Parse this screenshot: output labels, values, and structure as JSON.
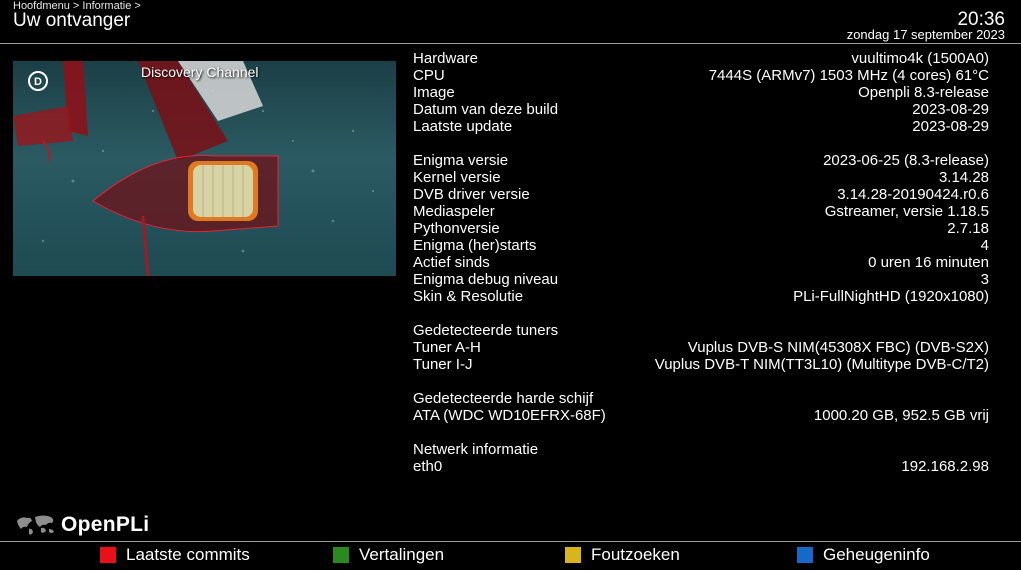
{
  "header": {
    "breadcrumb": "Hoofdmenu > Informatie >",
    "title": "Uw ontvanger",
    "time": "20:36",
    "date": "zondag 17 september 2023"
  },
  "preview": {
    "channel": "Discovery Channel",
    "logo_icon": "discovery-logo-icon"
  },
  "info": {
    "hardware": {
      "label": "Hardware",
      "value": "vuultimo4k (1500A0)"
    },
    "cpu": {
      "label": "CPU",
      "value": "7444S (ARMv7) 1503 MHz (4 cores) 61°C"
    },
    "image": {
      "label": "Image",
      "value": "Openpli 8.3-release"
    },
    "build_date": {
      "label": "Datum van deze build",
      "value": "2023-08-29"
    },
    "last_update": {
      "label": "Laatste update",
      "value": "2023-08-29"
    },
    "enigma_version": {
      "label": "Enigma versie",
      "value": "2023-06-25 (8.3-release)"
    },
    "kernel_version": {
      "label": "Kernel versie",
      "value": "3.14.28"
    },
    "dvb_driver": {
      "label": "DVB driver versie",
      "value": "3.14.28-20190424.r0.6"
    },
    "mediaplayer": {
      "label": "Mediaspeler",
      "value": "Gstreamer, versie 1.18.5"
    },
    "python": {
      "label": "Pythonversie",
      "value": "2.7.18"
    },
    "restarts": {
      "label": "Enigma (her)starts",
      "value": "4"
    },
    "active_since": {
      "label": "Actief sinds",
      "value": "0 uren 16 minuten"
    },
    "debug_level": {
      "label": "Enigma debug niveau",
      "value": "3"
    },
    "skin": {
      "label": "Skin & Resolutie",
      "value": "PLi-FullNightHD (1920x1080)"
    },
    "tuners_heading": "Gedetecteerde tuners",
    "tuner_ah": {
      "label": "Tuner A-H",
      "value": "Vuplus DVB-S NIM(45308X FBC) (DVB-S2X)"
    },
    "tuner_ij": {
      "label": "Tuner I-J",
      "value": "Vuplus DVB-T NIM(TT3L10) (Multitype DVB-C/T2)"
    },
    "hdd_heading": "Gedetecteerde harde schijf",
    "hdd": {
      "label": "ATA (WDC WD10EFRX-68F)",
      "value": "1000.20 GB, 952.5 GB vrij"
    },
    "network_heading": "Netwerk informatie",
    "eth0": {
      "label": "eth0",
      "value": "192.168.2.98"
    }
  },
  "brand": {
    "name": "OpenPLi",
    "icon": "world-map-icon"
  },
  "footer": {
    "red": {
      "label": "Laatste commits",
      "color": "#e8101a"
    },
    "green": {
      "label": "Vertalingen",
      "color": "#2b8a1e"
    },
    "yellow": {
      "label": "Foutzoeken",
      "color": "#d9b51c"
    },
    "blue": {
      "label": "Geheugeninfo",
      "color": "#1769c9"
    }
  }
}
